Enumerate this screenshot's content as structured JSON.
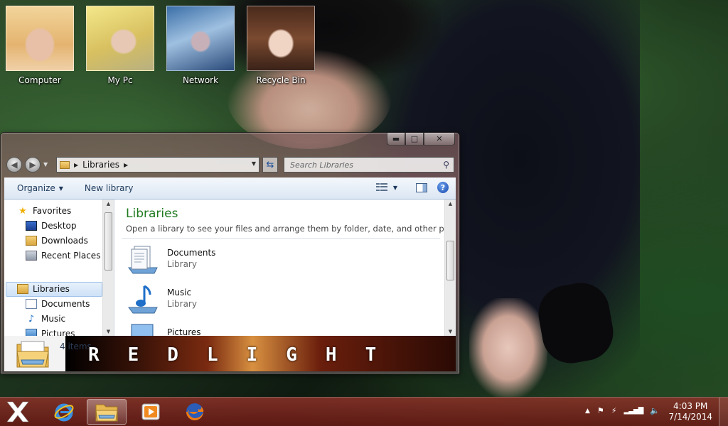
{
  "desktop": {
    "icons": [
      {
        "label": "Computer"
      },
      {
        "label": "My Pc"
      },
      {
        "label": "Network"
      },
      {
        "label": "Recycle Bin"
      }
    ]
  },
  "window": {
    "address": {
      "breadcrumb": "Libraries"
    },
    "search": {
      "placeholder": "Search Libraries"
    },
    "toolbar": {
      "organize": "Organize",
      "new_library": "New library"
    },
    "nav": {
      "favorites": "Favorites",
      "desktop": "Desktop",
      "downloads": "Downloads",
      "recent_places": "Recent Places",
      "libraries": "Libraries",
      "documents": "Documents",
      "music": "Music",
      "pictures": "Pictures"
    },
    "content": {
      "title": "Libraries",
      "description": "Open a library to see your files and arrange them by folder, date, and other prop...",
      "items": [
        {
          "name": "Documents",
          "type": "Library"
        },
        {
          "name": "Music",
          "type": "Library"
        },
        {
          "name": "Pictures",
          "type": ""
        }
      ]
    },
    "details": {
      "count": "4 items",
      "banner": "REDLIGHT"
    }
  },
  "taskbar": {
    "time": "4:03 PM",
    "date": "7/14/2014"
  }
}
